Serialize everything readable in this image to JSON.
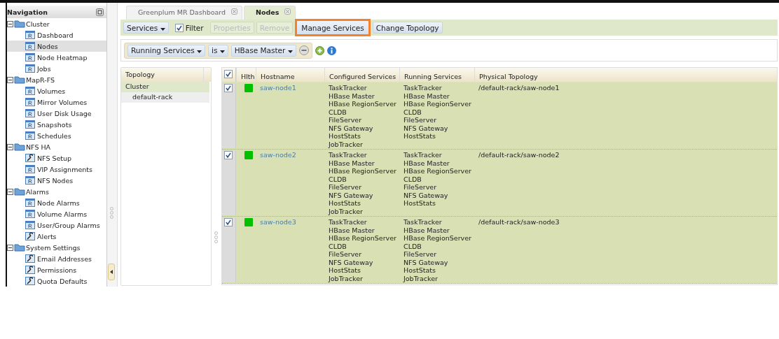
{
  "navigation": {
    "title": "Navigation",
    "groups": [
      {
        "label": "Cluster",
        "expanded": true,
        "items": [
          {
            "label": "Dashboard",
            "kind": "report",
            "selected": false
          },
          {
            "label": "Nodes",
            "kind": "report",
            "selected": true
          },
          {
            "label": "Node Heatmap",
            "kind": "report",
            "selected": false
          },
          {
            "label": "Jobs",
            "kind": "report",
            "selected": false
          }
        ]
      },
      {
        "label": "MapR-FS",
        "expanded": true,
        "items": [
          {
            "label": "Volumes",
            "kind": "report",
            "selected": false
          },
          {
            "label": "Mirror Volumes",
            "kind": "report",
            "selected": false
          },
          {
            "label": "User Disk Usage",
            "kind": "report",
            "selected": false
          },
          {
            "label": "Snapshots",
            "kind": "report",
            "selected": false
          },
          {
            "label": "Schedules",
            "kind": "report",
            "selected": false
          }
        ]
      },
      {
        "label": "NFS HA",
        "expanded": true,
        "items": [
          {
            "label": "NFS Setup",
            "kind": "tool",
            "selected": false
          },
          {
            "label": "VIP Assignments",
            "kind": "report",
            "selected": false
          },
          {
            "label": "NFS Nodes",
            "kind": "report",
            "selected": false
          }
        ]
      },
      {
        "label": "Alarms",
        "expanded": true,
        "items": [
          {
            "label": "Node Alarms",
            "kind": "report",
            "selected": false
          },
          {
            "label": "Volume Alarms",
            "kind": "report",
            "selected": false
          },
          {
            "label": "User/Group Alarms",
            "kind": "report",
            "selected": false
          },
          {
            "label": "Alerts",
            "kind": "tool",
            "selected": false
          }
        ]
      },
      {
        "label": "System Settings",
        "expanded": true,
        "items": [
          {
            "label": "Email Addresses",
            "kind": "tool",
            "selected": false
          },
          {
            "label": "Permissions",
            "kind": "tool",
            "selected": false
          },
          {
            "label": "Quota Defaults",
            "kind": "tool",
            "selected": false
          }
        ]
      }
    ]
  },
  "tabs": [
    {
      "label": "Greenplum MR Dashboard",
      "selected": false
    },
    {
      "label": "Nodes",
      "selected": true
    }
  ],
  "toolbar": [
    {
      "kind": "menu",
      "label": "Services",
      "disabled": false,
      "highlighted": false
    },
    {
      "kind": "checkbox",
      "label": "Filter",
      "checked": true
    },
    {
      "kind": "button",
      "label": "Properties",
      "disabled": true,
      "highlighted": false
    },
    {
      "kind": "button",
      "label": "Remove",
      "disabled": true,
      "highlighted": false
    },
    {
      "kind": "button",
      "label": "Manage Services",
      "disabled": false,
      "highlighted": true
    },
    {
      "kind": "button",
      "label": "Change Topology",
      "disabled": false,
      "highlighted": false
    }
  ],
  "filter": {
    "field": "Running Services",
    "operator": "is",
    "value": "HBase Master"
  },
  "topology": {
    "title": "Topology",
    "items": [
      {
        "label": "Cluster",
        "selected": false,
        "children": [
          {
            "label": "default-rack",
            "selected": true
          }
        ]
      }
    ]
  },
  "table": {
    "all_checked": true,
    "columns": [
      "Hlth",
      "Hostname",
      "Configured Services",
      "Running Services",
      "Physical Topology"
    ],
    "rows": [
      {
        "checked": true,
        "color": "#00c000",
        "hostname": "saw-node1",
        "configured": [
          "TaskTracker",
          "HBase Master",
          "HBase RegionServer",
          "CLDB",
          "FileServer",
          "NFS Gateway",
          "HostStats",
          "JobTracker"
        ],
        "running": [
          "TaskTracker",
          "HBase Master",
          "HBase RegionServer",
          "CLDB",
          "FileServer",
          "NFS Gateway",
          "HostStats"
        ],
        "physical": "/default-rack/saw-node1"
      },
      {
        "checked": true,
        "color": "#00c000",
        "hostname": "saw-node2",
        "configured": [
          "TaskTracker",
          "HBase Master",
          "HBase RegionServer",
          "CLDB",
          "FileServer",
          "NFS Gateway",
          "HostStats",
          "JobTracker"
        ],
        "running": [
          "TaskTracker",
          "HBase Master",
          "HBase RegionServer",
          "CLDB",
          "FileServer",
          "NFS Gateway",
          "HostStats"
        ],
        "physical": "/default-rack/saw-node2"
      },
      {
        "checked": true,
        "color": "#00c000",
        "hostname": "saw-node3",
        "configured": [
          "TaskTracker",
          "HBase Master",
          "HBase RegionServer",
          "CLDB",
          "FileServer",
          "NFS Gateway",
          "HostStats",
          "JobTracker"
        ],
        "running": [
          "TaskTracker",
          "HBase Master",
          "HBase RegionServer",
          "CLDB",
          "FileServer",
          "NFS Gateway",
          "HostStats",
          "JobTracker"
        ],
        "physical": "/default-rack/saw-node3"
      }
    ]
  }
}
